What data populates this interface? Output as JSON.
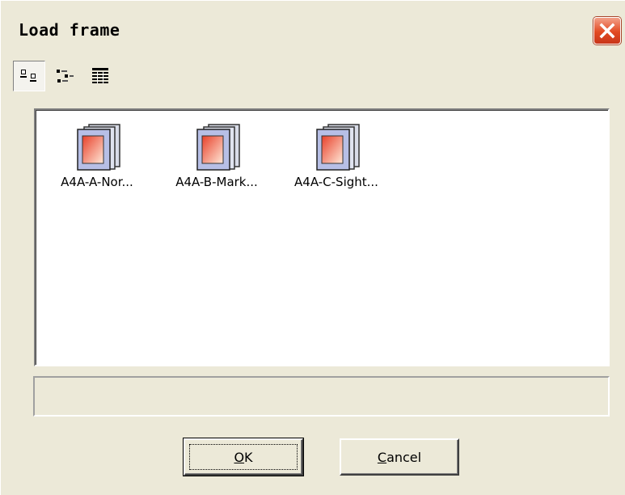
{
  "window": {
    "title": "Load frame"
  },
  "toolbar": {
    "buttons": [
      {
        "name": "large-icons-view",
        "icon": "large-icons-icon",
        "pressed": true
      },
      {
        "name": "list-view",
        "icon": "list-view-icon",
        "pressed": false
      },
      {
        "name": "details-view",
        "icon": "details-view-icon",
        "pressed": false
      }
    ]
  },
  "files": [
    {
      "label": "A4A-A-Nor..."
    },
    {
      "label": "A4A-B-Mark..."
    },
    {
      "label": "A4A-C-Sight..."
    }
  ],
  "status": {
    "text": ""
  },
  "buttons": {
    "ok": {
      "mnemonic": "O",
      "rest": "K"
    },
    "cancel": {
      "mnemonic": "C",
      "rest": "ancel"
    }
  },
  "colors": {
    "dialog_bg": "#ece9d8",
    "close_button": "#e24a22"
  }
}
